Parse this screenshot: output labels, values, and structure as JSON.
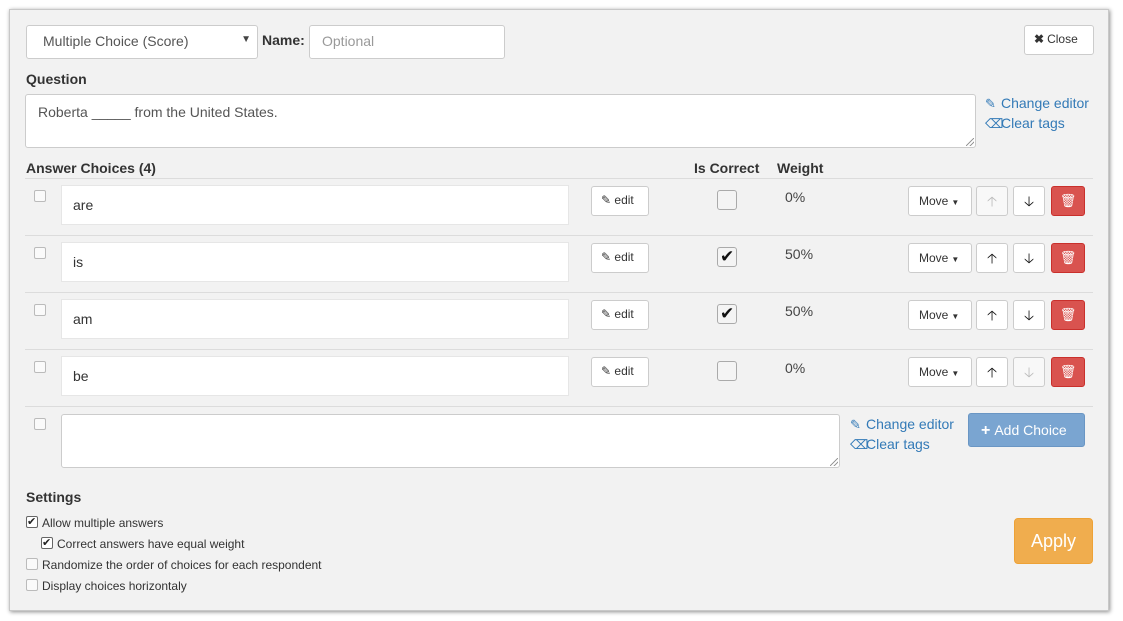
{
  "header": {
    "type_select": "Multiple Choice (Score)",
    "name_label": "Name:",
    "name_placeholder": "Optional",
    "close_label": "Close"
  },
  "question": {
    "label": "Question",
    "text": "Roberta _____ from the United States.",
    "change_editor": "Change editor",
    "clear_tags": "Clear tags"
  },
  "answers": {
    "label": "Answer Choices (4)",
    "col_correct": "Is Correct",
    "col_weight": "Weight",
    "edit_label": "edit",
    "move_label": "Move",
    "rows": [
      {
        "text": "are",
        "correct": false,
        "weight": "0%"
      },
      {
        "text": "is",
        "correct": true,
        "weight": "50%"
      },
      {
        "text": "am",
        "correct": true,
        "weight": "50%"
      },
      {
        "text": "be",
        "correct": false,
        "weight": "0%"
      }
    ]
  },
  "new_choice": {
    "change_editor": "Change editor",
    "clear_tags": "Clear tags",
    "add_label": "Add Choice"
  },
  "settings": {
    "label": "Settings",
    "options": [
      {
        "label": "Allow multiple answers",
        "checked": true
      },
      {
        "label": "Correct answers have equal weight",
        "checked": true
      },
      {
        "label": "Randomize the order of choices for each respondent",
        "checked": false
      },
      {
        "label": "Display choices horizontaly",
        "checked": false
      }
    ],
    "apply_label": "Apply"
  },
  "colors": {
    "link": "#337ab7",
    "danger": "#d9534f",
    "primary_light": "#7aa5d1",
    "warning": "#f0ad4e"
  }
}
